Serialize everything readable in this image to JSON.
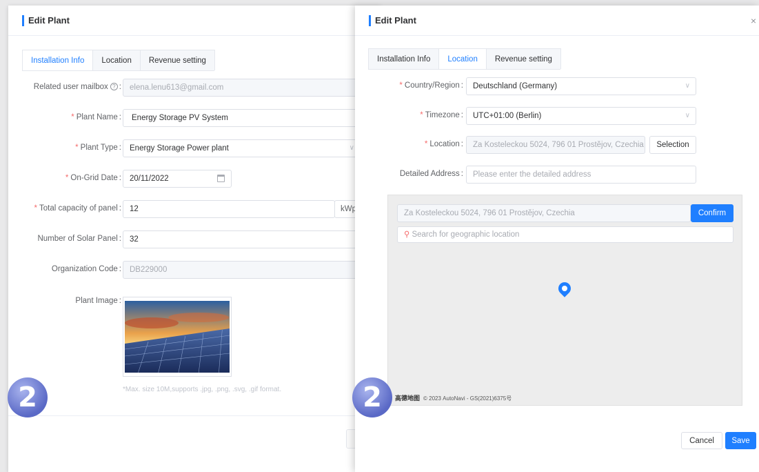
{
  "left_dialog": {
    "title": "Edit Plant",
    "tabs": [
      "Installation Info",
      "Location",
      "Revenue setting"
    ],
    "fields": {
      "mailbox": {
        "label": "Related user mailbox",
        "value": "elena.lenu613@gmail.com"
      },
      "plant_name": {
        "label": "Plant Name",
        "value": "Energy Storage PV System"
      },
      "plant_type": {
        "label": "Plant Type",
        "value": "Energy Storage Power plant"
      },
      "on_grid_date": {
        "label": "On-Grid Date",
        "value": "20/11/2022"
      },
      "capacity": {
        "label": "Total capacity of panel",
        "value": "12",
        "unit": "kWp"
      },
      "solar_panel_count": {
        "label": "Number of Solar Panel",
        "value": "32"
      },
      "org_code": {
        "label": "Organization Code",
        "value": "DB229000"
      },
      "plant_image": {
        "label": "Plant Image",
        "hint": "*Max. size 10M,supports .jpg, .png, .svg, .gif format."
      }
    },
    "badge": "2"
  },
  "right_dialog": {
    "title": "Edit Plant",
    "close": "×",
    "tabs": [
      "Installation Info",
      "Location",
      "Revenue setting"
    ],
    "fields": {
      "country": {
        "label": "Country/Region",
        "value": "Deutschland (Germany)"
      },
      "timezone": {
        "label": "Timezone",
        "value": "UTC+01:00 (Berlin)"
      },
      "location": {
        "label": "Location",
        "value": "Za Kosteleckou 5024, 796 01 Prostějov, Czechia",
        "button": "Selection"
      },
      "detailed_address": {
        "label": "Detailed Address",
        "placeholder": "Please enter the detailed address"
      }
    },
    "map": {
      "address_value": "Za Kosteleckou 5024, 796 01 Prostějov, Czechia",
      "confirm": "Confirm",
      "search_placeholder": "Search for geographic location",
      "brand": "高德地图",
      "attribution": "© 2023 AutoNavi - GS(2021)6375号"
    },
    "footer": {
      "cancel": "Cancel",
      "save": "Save"
    },
    "badge": "2"
  }
}
